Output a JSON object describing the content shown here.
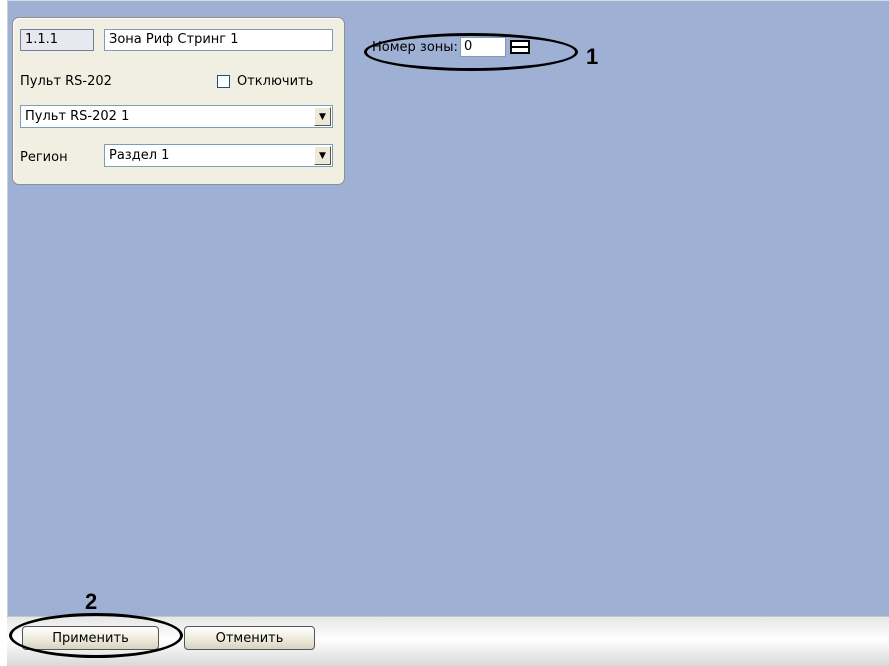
{
  "panel": {
    "id_value": "1.1.1",
    "name_value": "Зона Риф Стринг 1",
    "console_label": "Пульт RS-202",
    "disable_label": "Отключить",
    "disable_checked": false,
    "console_select": "Пульт RS-202 1",
    "region_label": "Регион",
    "region_select": "Раздел 1"
  },
  "zone": {
    "label": "Номер зоны:",
    "value": "0"
  },
  "callouts": {
    "one": "1",
    "two": "2"
  },
  "buttons": {
    "apply": "Применить",
    "cancel": "Отменить"
  },
  "colors": {
    "background": "#9fb0d5",
    "panel": "#f1efe2"
  }
}
